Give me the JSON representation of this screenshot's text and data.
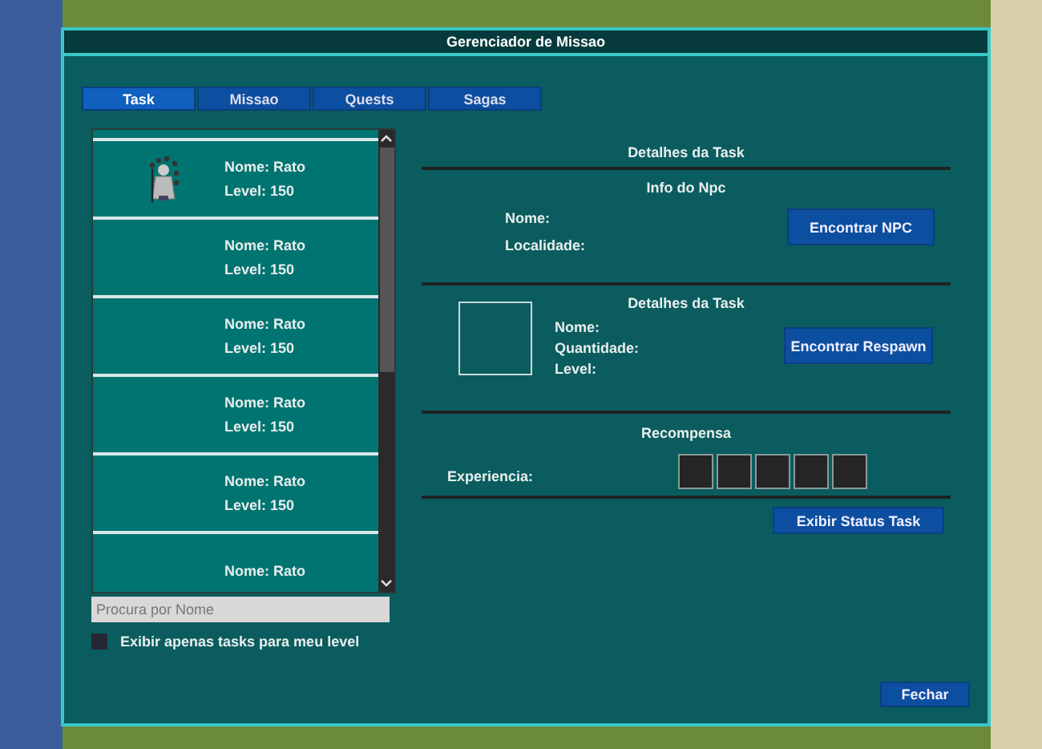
{
  "window": {
    "title": "Gerenciador de Missao"
  },
  "tabs": [
    {
      "label": "Task",
      "selected": true
    },
    {
      "label": "Missao",
      "selected": false
    },
    {
      "label": "Quests",
      "selected": false
    },
    {
      "label": "Sagas",
      "selected": false
    }
  ],
  "task_list": [
    {
      "kind": "sprite",
      "name": "Nome: Rato",
      "level": "Level: 150"
    },
    {
      "kind": "plain",
      "name": "Nome: Rato",
      "level": "Level: 150"
    },
    {
      "kind": "plain",
      "name": "Nome: Rato",
      "level": "Level: 150"
    },
    {
      "kind": "plain",
      "name": "Nome: Rato",
      "level": "Level: 150"
    },
    {
      "kind": "plain",
      "name": "Nome: Rato",
      "level": "Level: 150"
    },
    {
      "kind": "plain",
      "name": "Nome: Rato"
    }
  ],
  "search": {
    "placeholder": "Procura por Nome"
  },
  "filter": {
    "label": "Exibir apenas tasks para meu level",
    "checked": false
  },
  "details": {
    "title": "Detalhes da Task",
    "npc": {
      "title": "Info do Npc",
      "fields": [
        "Nome:",
        "Localidade:"
      ],
      "button": "Encontrar NPC"
    },
    "task": {
      "title": "Detalhes da Task",
      "fields": [
        "Nome:",
        "Quantidade:",
        "Level:"
      ],
      "button": "Encontrar Respawn"
    },
    "reward": {
      "title": "Recompensa",
      "label": "Experiencia:",
      "slots": [
        {
          "filled": false
        },
        {
          "filled": false
        },
        {
          "filled": false
        },
        {
          "filled": false
        },
        {
          "filled": false
        }
      ]
    },
    "status_button": "Exibir Status Task"
  },
  "close_button": "Fechar"
}
